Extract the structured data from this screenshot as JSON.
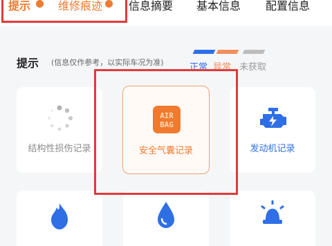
{
  "tabs": [
    {
      "label": "提示",
      "active": true
    },
    {
      "label": "维修痕迹"
    },
    {
      "label": "信息摘要"
    },
    {
      "label": "基本信息"
    },
    {
      "label": "配置信息"
    }
  ],
  "section": {
    "title": "提示",
    "note": "(信息仅作参考，以实际车况为准)"
  },
  "legend": [
    {
      "label": "正常",
      "color": "#2f6fe6"
    },
    {
      "label": "异常",
      "color": "#f0905a"
    },
    {
      "label": "未获取",
      "color": "#bdbdbd"
    }
  ],
  "cards": [
    {
      "label": "结构性损伤记录",
      "icon": "loading-spinner-icon",
      "color": "#8a8a8a"
    },
    {
      "label": "安全气囊记录",
      "icon": "airbag-icon",
      "color": "#f07a2e",
      "icon_text": "AIR BAG"
    },
    {
      "label": "发动机记录",
      "icon": "engine-icon",
      "color": "#2f6fe6"
    }
  ],
  "bottom_cards": [
    {
      "icon": "fire-icon"
    },
    {
      "icon": "water-drop-icon"
    },
    {
      "icon": "light-bulb-icon"
    }
  ]
}
